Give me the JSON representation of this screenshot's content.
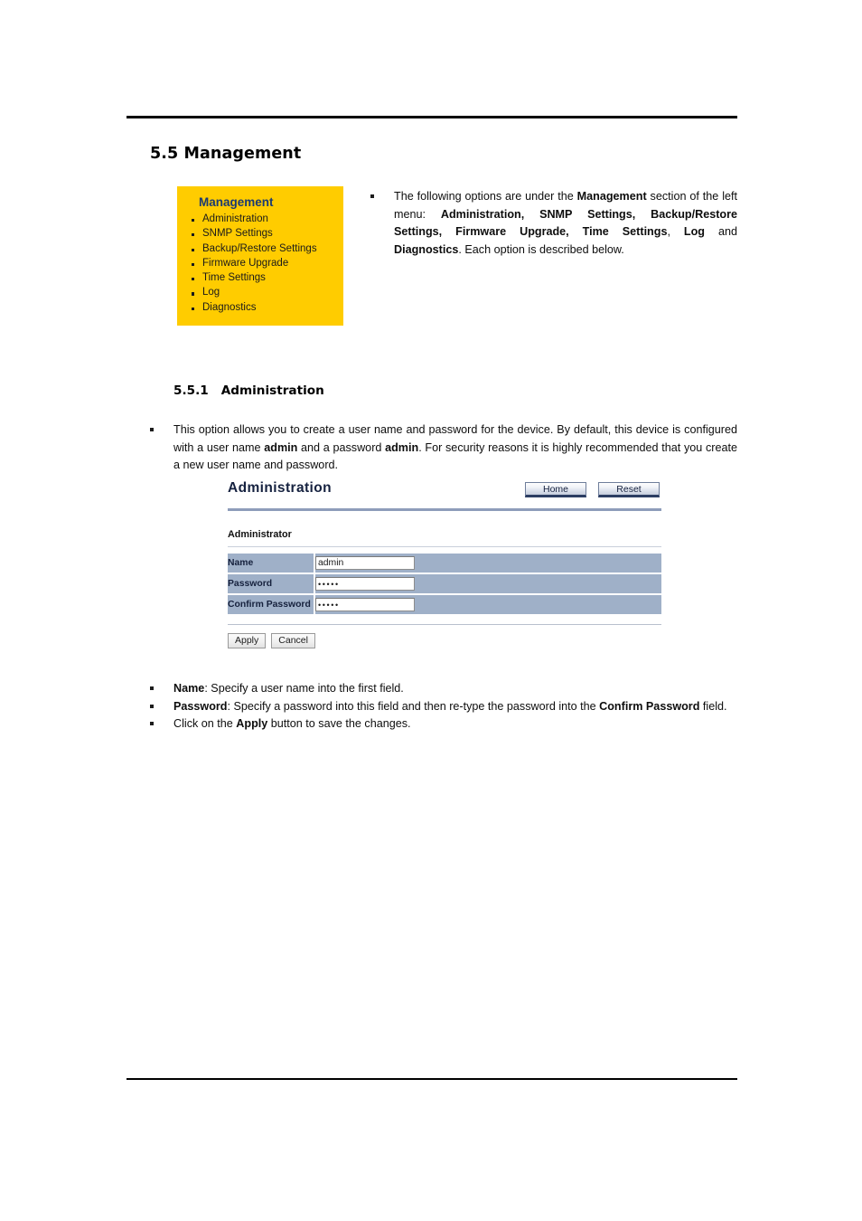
{
  "page": {
    "section_heading": "5.5 Management",
    "sub_heading_number": "5.5.1",
    "sub_heading_title": "Administration"
  },
  "yellow_menu": {
    "title": "Management",
    "items": [
      "Administration",
      "SNMP Settings",
      "Backup/Restore Settings",
      "Firmware Upgrade",
      "Time Settings",
      "Log",
      "Diagnostics"
    ]
  },
  "management_paragraph": {
    "p1": "The following options are under the ",
    "b1": "Management",
    "p2": " section of the left menu: ",
    "b2": "Administration, SNMP Settings, Backup/Restore Settings, Firmware Upgrade, Time Settings",
    "p3": ", ",
    "b3": "Log",
    "p4": " and ",
    "b4": "Diagnostics",
    "p5": ". Each option is described below."
  },
  "intro_paragraph": {
    "p1": "This option allows you to create a user name and password for the device. By default, this device is configured with a user name ",
    "b1": "admin",
    "p2": " and a password ",
    "b2": "admin",
    "p3": ". For security reasons it is highly recommended that you create a new user name and password."
  },
  "webui": {
    "title": "Administration",
    "home_button": "Home",
    "reset_button": "Reset",
    "section_label": "Administrator",
    "rows": [
      {
        "label": "Name",
        "value": "admin",
        "masked": false
      },
      {
        "label": "Password",
        "value": "•••••",
        "masked": true
      },
      {
        "label": "Confirm Password",
        "value": "•••••",
        "masked": true
      }
    ],
    "apply_button": "Apply",
    "cancel_button": "Cancel"
  },
  "bottom_bullets": {
    "b1_bold": "Name",
    "b1_text": ": Specify a user name into the first field.",
    "b2_bold": "Password",
    "b2_text": ": Specify a password into this field and then re-type the password into the ",
    "b2_bold2": "Confirm Password",
    "b2_text2": " field.",
    "b3_text1": "Click on the ",
    "b3_bold": "Apply",
    "b3_text2": " button to save the changes."
  },
  "colors": {
    "menu_background": "#FFCC00",
    "menu_title": "#1b3a73",
    "table_row": "#9fb0c8",
    "webui_rule": "#8e9dba"
  }
}
